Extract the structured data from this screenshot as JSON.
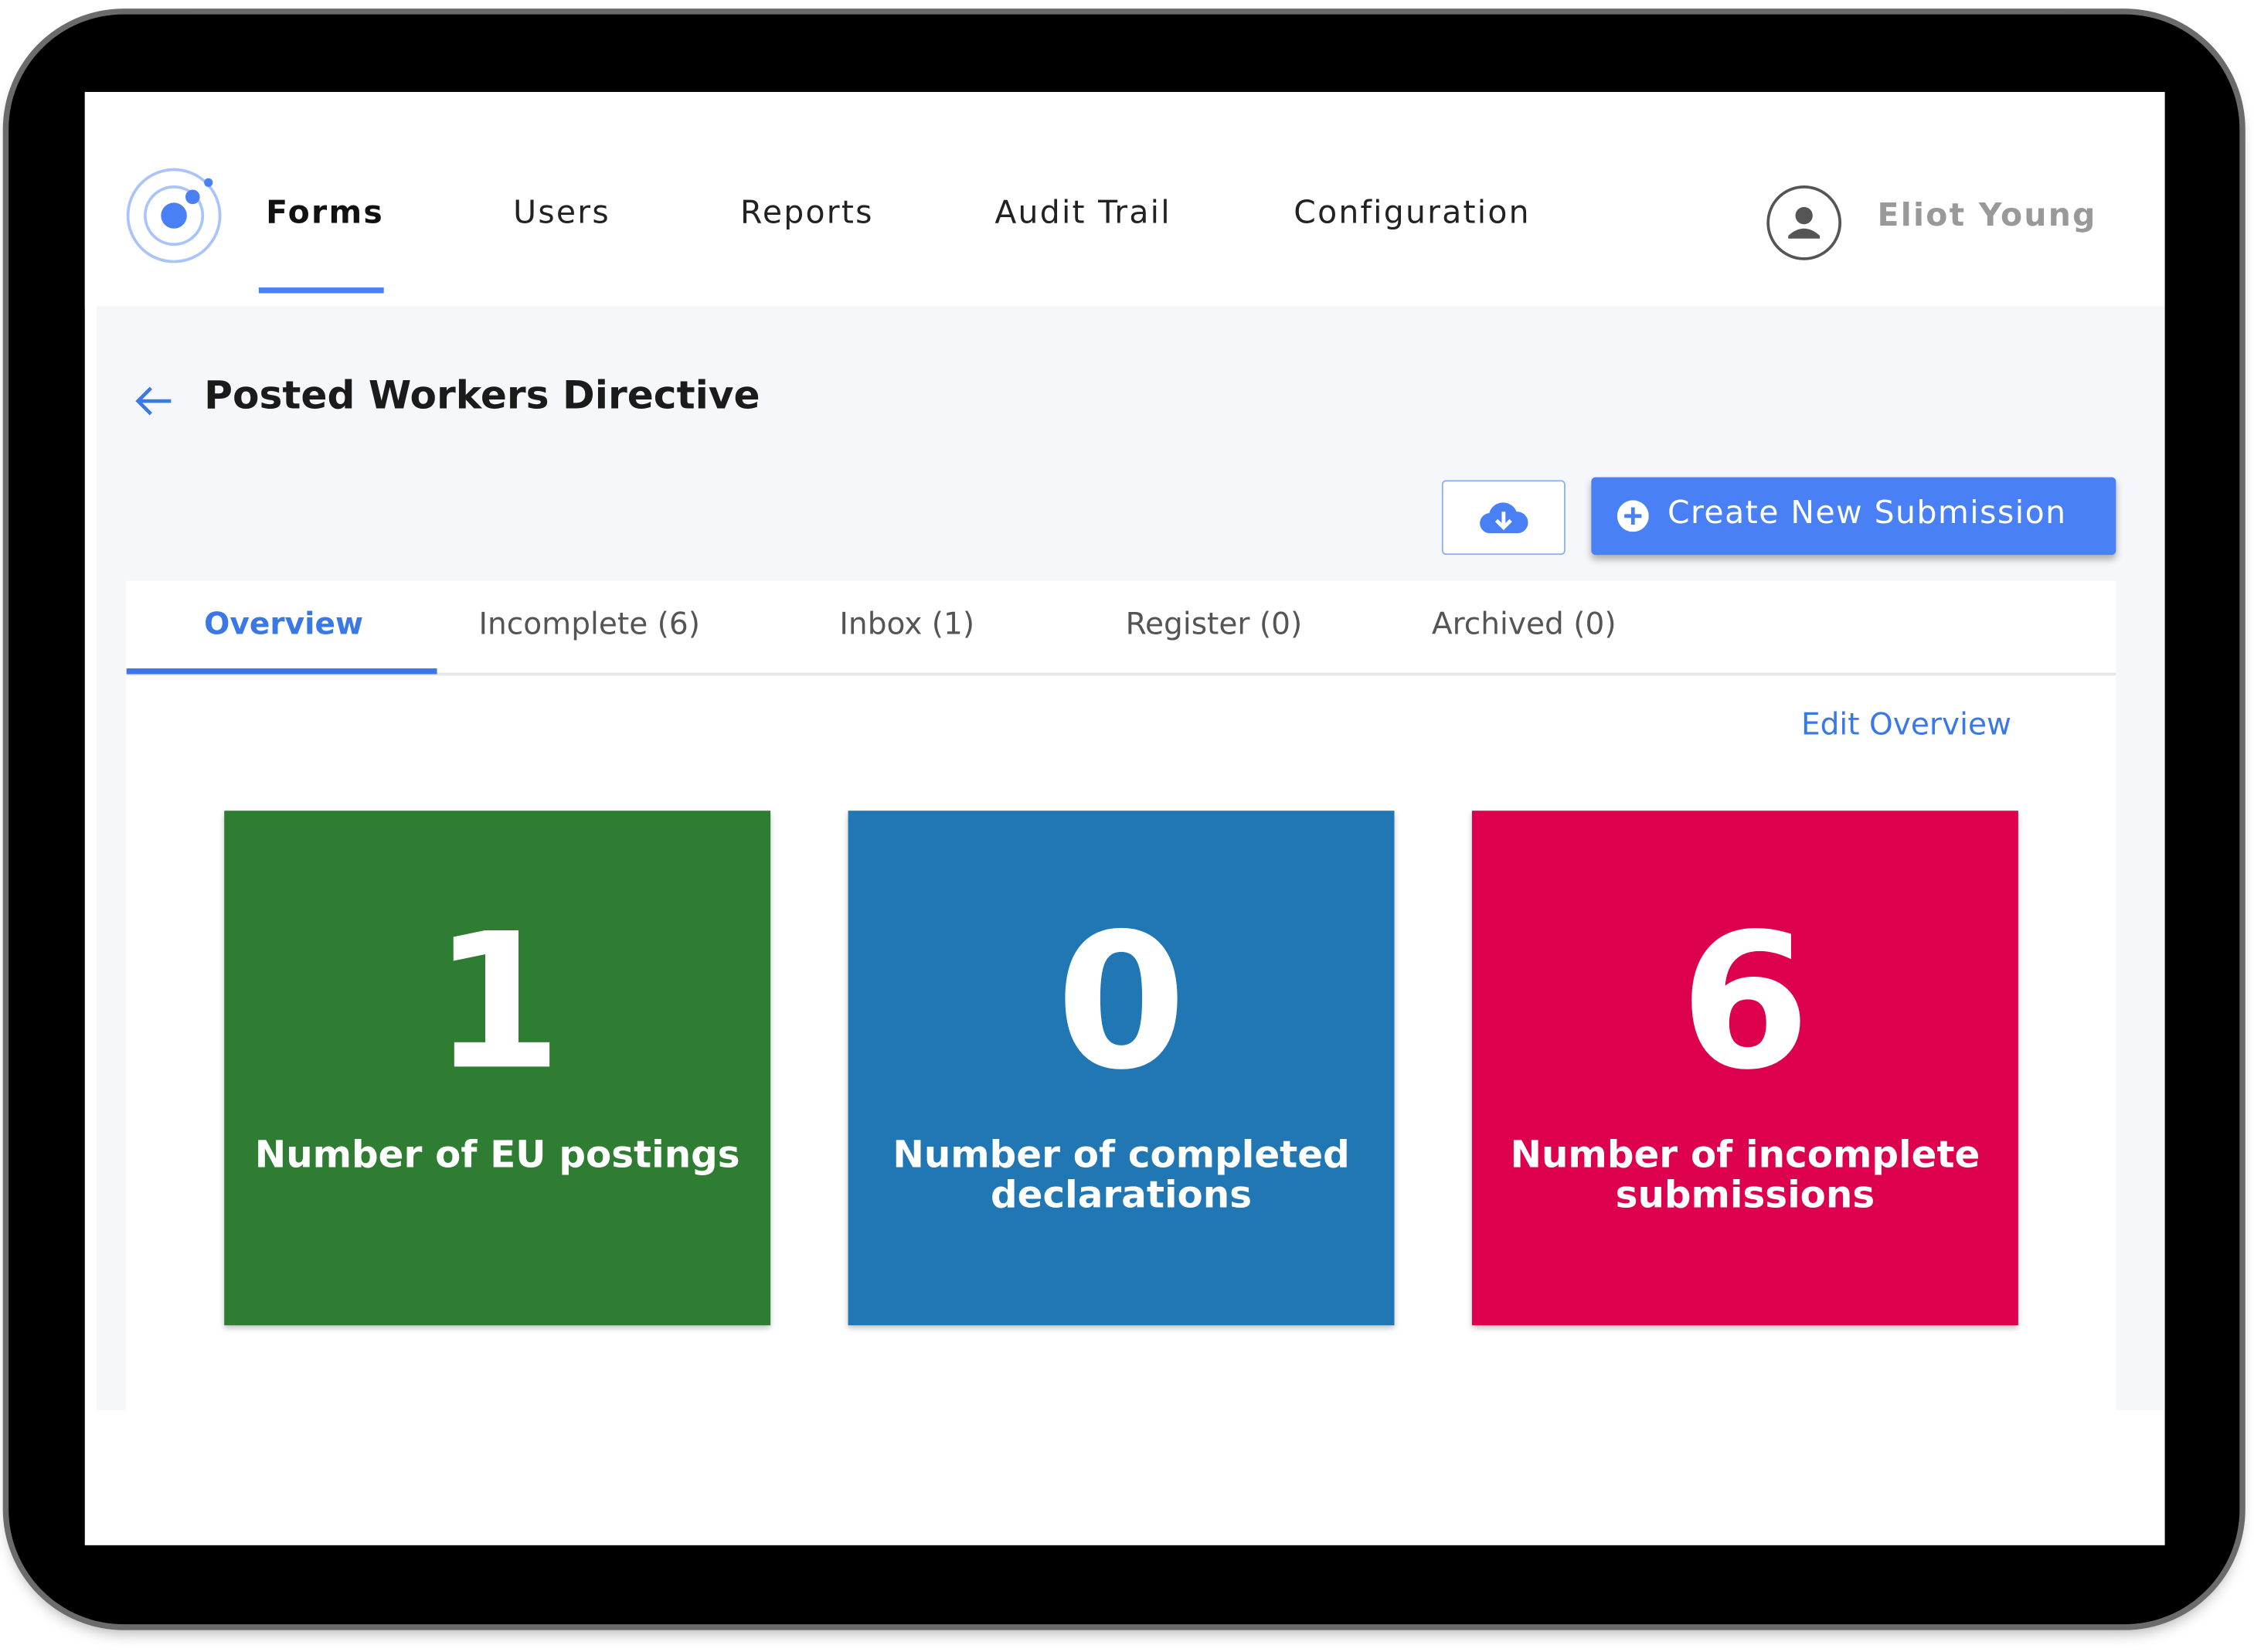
{
  "nav": {
    "items": [
      {
        "label": "Forms",
        "active": true
      },
      {
        "label": "Users"
      },
      {
        "label": "Reports"
      },
      {
        "label": "Audit Trail"
      },
      {
        "label": "Configuration"
      }
    ],
    "user_name": "Eliot Young"
  },
  "page": {
    "title": "Posted Workers Directive",
    "create_label": "Create New Submission",
    "edit_label": "Edit Overview"
  },
  "tabs": [
    {
      "label": "Overview"
    },
    {
      "label": "Incomplete (6)"
    },
    {
      "label": "Inbox (1)"
    },
    {
      "label": "Register (0)"
    },
    {
      "label": "Archived (0)"
    }
  ],
  "cards": [
    {
      "value": "1",
      "label": "Number of EU postings",
      "color": "#2e7d32"
    },
    {
      "value": "0",
      "label": "Number of completed declarations",
      "color": "#2077b4"
    },
    {
      "value": "6",
      "label": "Number of incomplete submissions",
      "color": "#dc004e"
    }
  ],
  "colors": {
    "accent": "#4a80f5"
  }
}
